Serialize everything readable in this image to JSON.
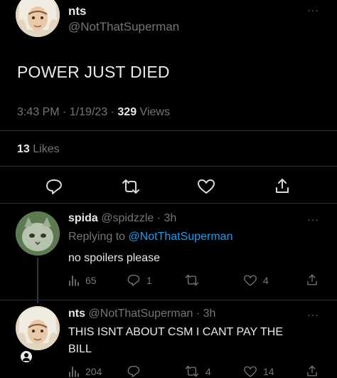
{
  "main_tweet": {
    "display_name": "nts",
    "handle": "@NotThatSuperman",
    "text": "POWER JUST DIED",
    "time": "3:43 PM · 1/19/23 · ",
    "views_count": "329",
    "views_label": " Views",
    "likes_count": "13",
    "likes_label": " Likes",
    "more": "···"
  },
  "replies": [
    {
      "display_name": "spida",
      "handle_time": "@spidzzle · 3h",
      "replying_prefix": "Replying to ",
      "replying_to": "@NotThatSuperman",
      "text": "no spoilers please",
      "views": "65",
      "replies": "1",
      "retweets": "",
      "likes": "4",
      "more": "···"
    },
    {
      "display_name": "nts",
      "handle_time": "@NotThatSuperman · 3h",
      "text_line1": "THIS ISNT ABOUT CSM I CANT PAY THE",
      "text_line2": "BILL",
      "views": "204",
      "replies": "",
      "retweets": "4",
      "likes": "14",
      "more": "···"
    }
  ],
  "colors": {
    "background": "#000000",
    "text": "#e7e9ea",
    "muted": "#71767b",
    "accent": "#1d9bf0",
    "divider": "#2f3336"
  }
}
